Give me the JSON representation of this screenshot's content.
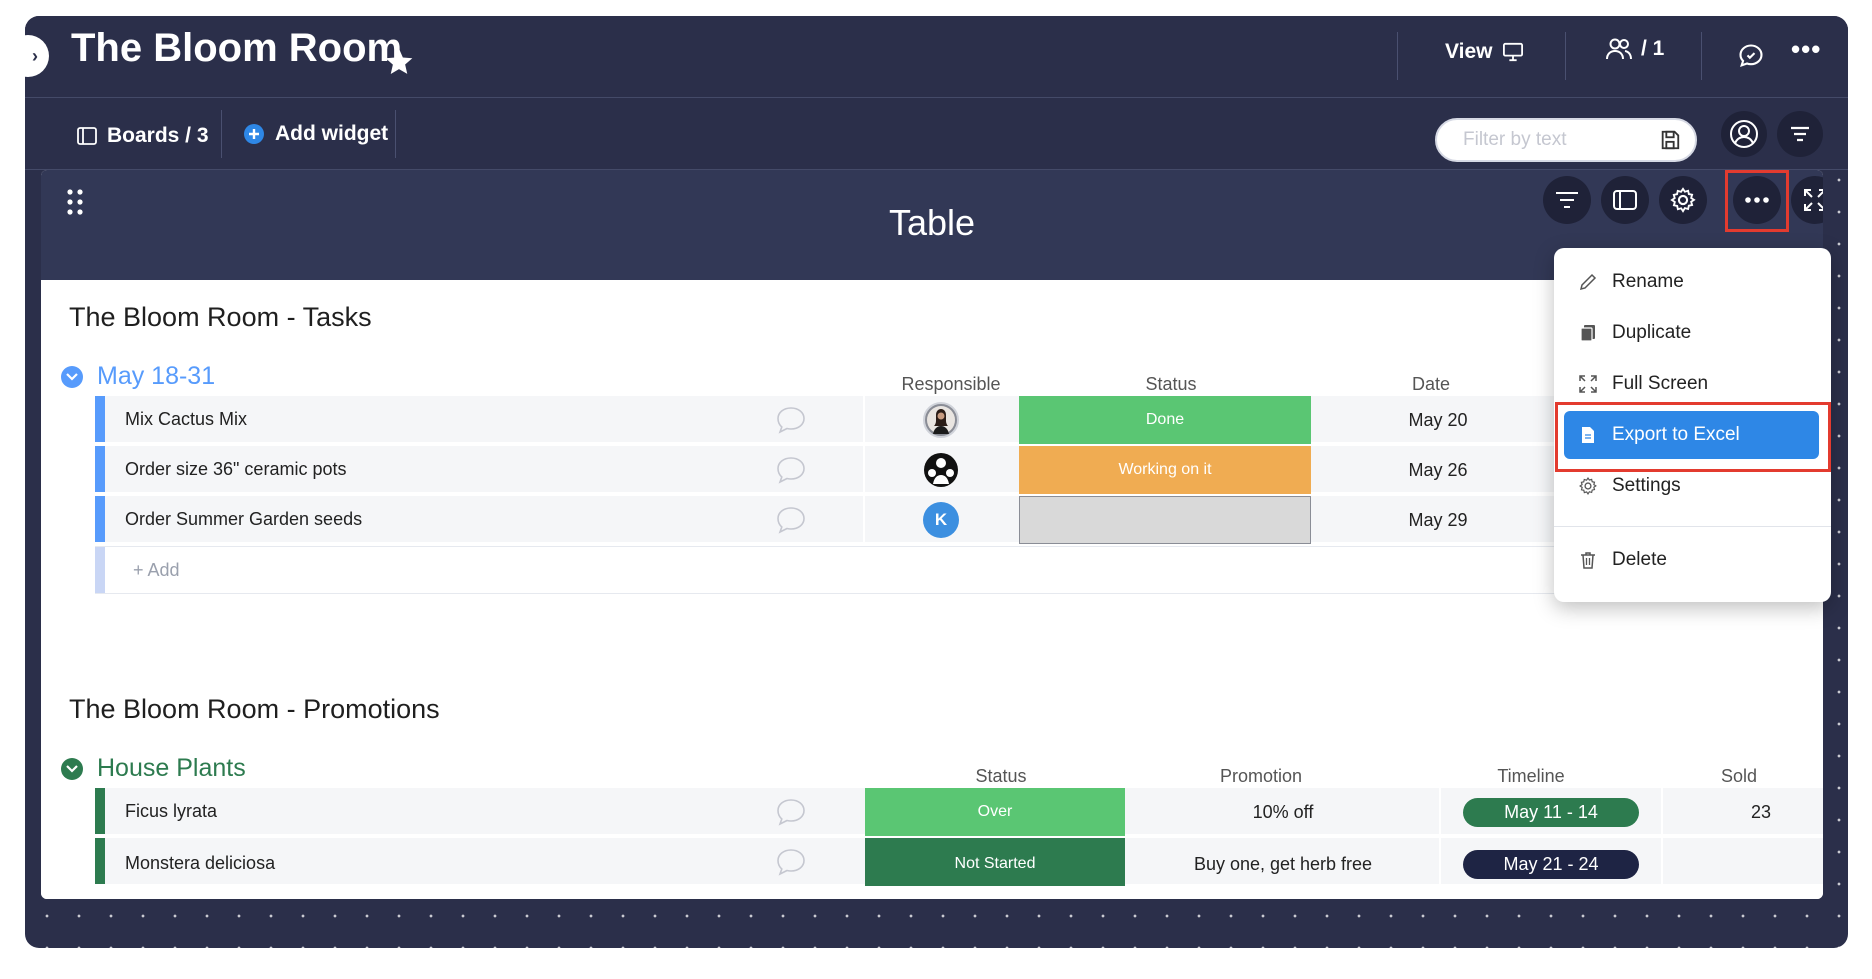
{
  "header": {
    "title": "The Bloom Room",
    "view_label": "View",
    "members_label": "/ 1"
  },
  "subbar": {
    "boards_label": "Boards / 3",
    "add_widget_label": "Add widget",
    "filter_placeholder": "Filter by text"
  },
  "widget": {
    "title": "Table",
    "menu": {
      "rename": "Rename",
      "duplicate": "Duplicate",
      "full_screen": "Full Screen",
      "export": "Export to Excel",
      "settings": "Settings",
      "delete": "Delete"
    }
  },
  "tasks": {
    "title": "The Bloom Room - Tasks",
    "group": "May 18-31",
    "columns": {
      "responsible": "Responsible",
      "status": "Status",
      "date": "Date"
    },
    "rows": [
      {
        "name": "Mix Cactus Mix",
        "status": "Done",
        "date": "May 20",
        "avatar": "photo"
      },
      {
        "name": "Order size 36\" ceramic pots",
        "status": "Working on it",
        "date": "May 26",
        "avatar": "people-icon"
      },
      {
        "name": "Order Summer Garden seeds",
        "status": "",
        "date": "May 29",
        "avatar_initial": "K"
      }
    ],
    "add_label": "+ Add"
  },
  "promotions": {
    "title": "The Bloom Room - Promotions",
    "group": "House Plants",
    "columns": {
      "status": "Status",
      "promotion": "Promotion",
      "timeline": "Timeline",
      "sold": "Sold"
    },
    "rows": [
      {
        "name": "Ficus lyrata",
        "status": "Over",
        "promotion": "10% off",
        "timeline": "May 11 - 14",
        "sold": "23"
      },
      {
        "name": "Monstera deliciosa",
        "status": "Not Started",
        "promotion": "Buy one, get herb free",
        "timeline": "May 21 - 24",
        "sold": ""
      }
    ]
  },
  "colors": {
    "done": "#5ac673",
    "working": "#f0ac52",
    "empty": "#d9d9d9",
    "over": "#5ac673",
    "not_started": "#2d7b4f",
    "timeline_1": "#2d7b4f",
    "timeline_2": "#1e2444",
    "accent": "#2e87e6",
    "highlight": "#e33b2f"
  }
}
